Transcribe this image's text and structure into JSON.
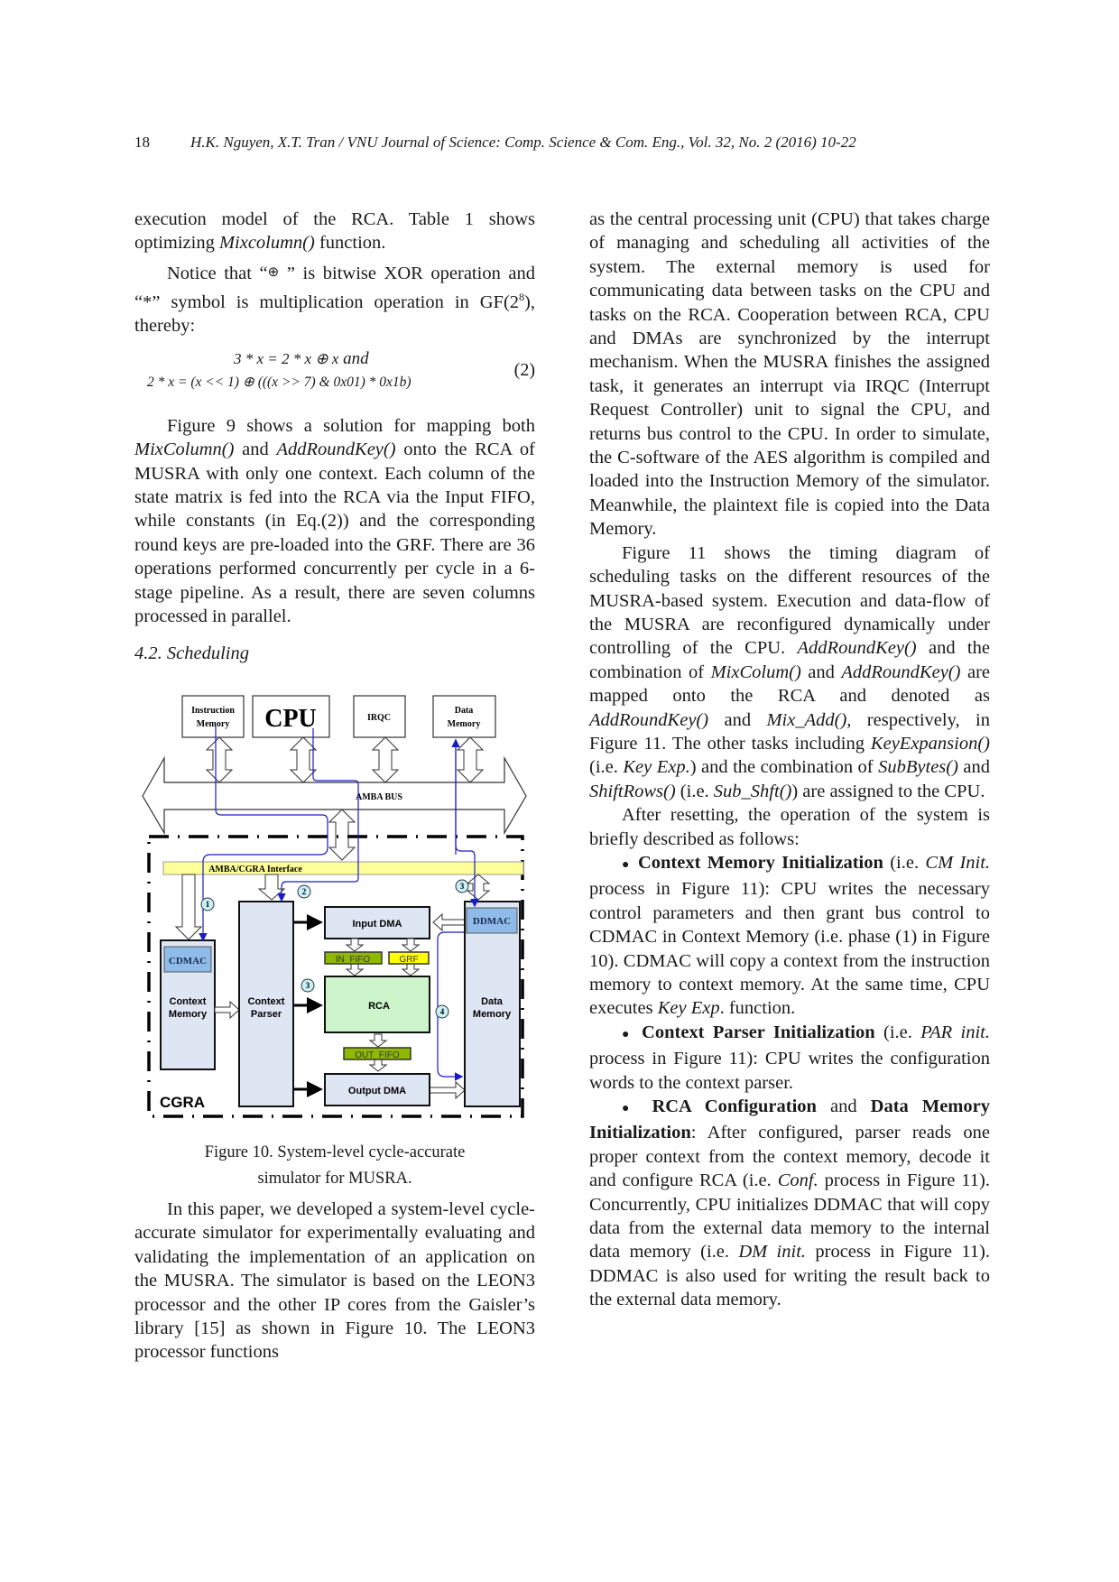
{
  "header": {
    "page_number": "18",
    "running_title": "H.K. Nguyen, X.T. Tran / VNU Journal of Science: Comp. Science & Com. Eng., Vol. 32, No. 2 (2016) 10-22"
  },
  "left_column": {
    "p1_a": "execution model of the RCA. Table 1 shows optimizing ",
    "p1_fn": "Mixcolumn()",
    "p1_b": " function.",
    "p2_a": "Notice that “",
    "p2_xor": "⊕",
    "p2_b": " ” is bitwise XOR operation and “*” symbol is multiplication operation in GF(2",
    "p2_sup": "8",
    "p2_c": "), thereby:",
    "equation": {
      "line1_a": "3 * x = 2 * x ⊕ x",
      "line1_and": " and",
      "line2": "2 * x = (x << 1) ⊕ (((x >> 7) & 0x01) * 0x1b)",
      "number": "(2)"
    },
    "p3_a": "Figure 9 shows a solution for mapping both ",
    "p3_fn1": "MixColumn()",
    "p3_b": " and ",
    "p3_fn2": "AddRoundKey()",
    "p3_c": " onto the RCA of MUSRA with only one context. Each column of the state matrix is fed into the RCA via the Input FIFO, while constants (in Eq.(2)) and the corresponding round keys are pre-loaded into the GRF. There are 36 operations performed concurrently per cycle in a 6-stage pipeline. As a result, there are seven columns processed in parallel.",
    "section_heading": "4.2. Scheduling",
    "figure": {
      "instruction_memory_l1": "Instruction",
      "instruction_memory_l2": "Memory",
      "cpu": "CPU",
      "irqc": "IRQC",
      "data_memory_top_l1": "Data",
      "data_memory_top_l2": "Memory",
      "amba_bus": "AMBA BUS",
      "interface": "AMBA/CGRA Interface",
      "cdmac": "CDMAC",
      "context_memory_l1": "Context",
      "context_memory_l2": "Memory",
      "context_parser_l1": "Context",
      "context_parser_l2": "Parser",
      "input_dma": "Input DMA",
      "in_fifo": "IN_FIFO",
      "grf": "GRF",
      "rca": "RCA",
      "out_fifo": "OUT_FIFO",
      "output_dma": "Output DMA",
      "ddmac": "DDMAC",
      "data_memory_l1": "Data",
      "data_memory_l2": "Memory",
      "cgra": "CGRA",
      "step1": "1",
      "step2": "2",
      "step3a": "3",
      "step3b": "3",
      "step4": "4",
      "colors": {
        "interface_fill": "#ffff99",
        "block_fill": "#dfe6f3",
        "dmac_fill": "#8fbbe8",
        "fifo_fill": "#8fb800",
        "grf_fill": "#ffff00",
        "rca_fill": "#ccf5cc",
        "flow_line": "#1a1acc",
        "step_circle": "#c8f0f8"
      }
    },
    "caption_l1": "Figure 10. System-level cycle-accurate",
    "caption_l2": "simulator for MUSRA.",
    "p4": "In this paper, we developed a system-level cycle-accurate simulator for experimentally evaluating and validating the implementation of an application on the MUSRA. The simulator is based on the LEON3 processor and the other IP cores from the Gaisler’s library [15] as shown in Figure 10. The LEON3 processor functions"
  },
  "right_column": {
    "p1": "as the central processing unit (CPU) that takes charge of managing and scheduling all activities of the system. The external memory is used for communicating data between tasks on the CPU and tasks on the RCA. Cooperation between RCA, CPU and DMAs are synchronized by the interrupt mechanism. When the MUSRA finishes the assigned task, it generates an interrupt via IRQC (Interrupt Request Controller) unit to signal the CPU, and returns bus control to the CPU. In order to simulate, the C-software of the AES algorithm is compiled and loaded into the Instruction Memory of the simulator. Meanwhile, the plaintext file is copied into the Data Memory.",
    "p2_a": "Figure 11 shows the timing diagram of scheduling tasks on the different resources of the MUSRA-based system. Execution and data-flow of the MUSRA are reconfigured dynamically under controlling of the CPU. ",
    "p2_f1": "AddRoundKey()",
    "p2_b": " and the combination of ",
    "p2_f2": "MixColum()",
    "p2_c": " and ",
    "p2_f3": "AddRoundKey()",
    "p2_d": " are mapped onto the RCA and denoted as ",
    "p2_f4": "AddRoundKey()",
    "p2_e": " and ",
    "p2_f5": "Mix_Add(),",
    "p2_f": " respectively, in Figure 11. The other tasks including ",
    "p2_f6": "KeyExpansion()",
    "p2_g": " (i.e. ",
    "p2_f7": "Key Exp.",
    "p2_h": ") and the combination of ",
    "p2_f8": "SubBytes()",
    "p2_i": " and ",
    "p2_f9": "ShiftRows()",
    "p2_j": " (i.e. ",
    "p2_f10": "Sub_Shft()",
    "p2_k": ") are assigned to the CPU.",
    "p3": "After resetting, the operation of the system is briefly described as follows:",
    "b1_bold": "Context Memory Initialization",
    "b1_a": " (i.e. ",
    "b1_it": "CM Init.",
    "b1_b": " process in Figure 11): CPU writes the necessary control parameters and then grant bus control to CDMAC in Context Memory (i.e. phase (1) in Figure 10). CDMAC will copy a context from the instruction memory to context memory. At the same time, CPU executes ",
    "b1_it2": "Key Exp",
    "b1_c": ". function.",
    "b2_bold": "Context Parser Initialization",
    "b2_a": " (i.e. ",
    "b2_it": "PAR init.",
    "b2_b": " process in Figure 11): CPU writes the configuration words to the context parser.",
    "b3_bold1": "RCA Configuration",
    "b3_a": " and ",
    "b3_bold2": "Data Memory Initialization",
    "b3_b": ": After configured, parser reads one proper context from the context memory, decode it and configure RCA (i.e. ",
    "b3_it": "Conf.",
    "b3_c": " process in Figure 11). Concurrently, CPU initializes DDMAC that will copy data from the external data memory to the internal data memory (i.e. ",
    "b3_it2": "DM init.",
    "b3_d": " process in Figure 11). DDMAC is also used for writing the result back to the external data memory.",
    "bullet": "●"
  }
}
